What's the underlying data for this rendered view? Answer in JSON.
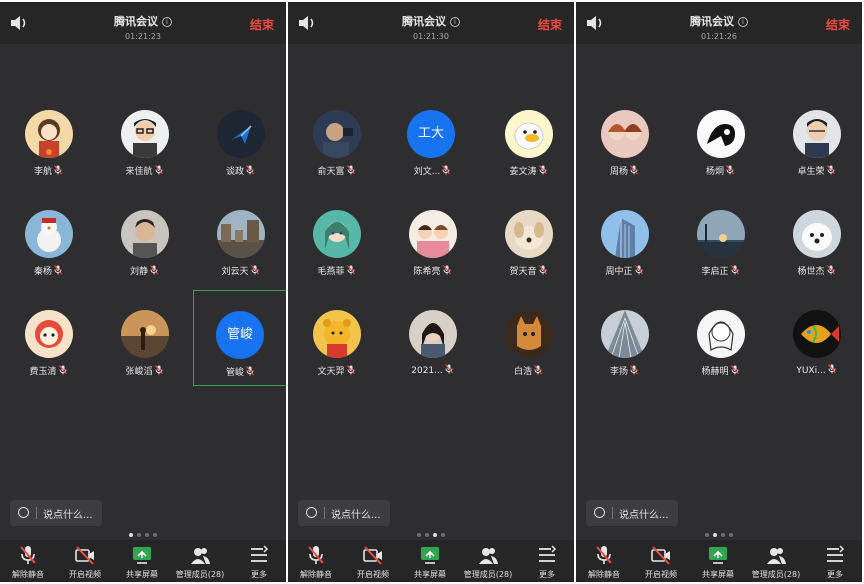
{
  "meeting": {
    "title": "腾讯会议",
    "end_label": "结束",
    "chat_placeholder": "说点什么..."
  },
  "toolbar": [
    {
      "label": "解除静音",
      "icon": "mic-muted-icon"
    },
    {
      "label": "开启视频",
      "icon": "video-off-icon"
    },
    {
      "label": "共享屏幕",
      "icon": "share-screen-icon"
    },
    {
      "label": "管理成员(28)",
      "icon": "members-icon"
    },
    {
      "label": "更多",
      "icon": "more-icon"
    }
  ],
  "panels": [
    {
      "time": "01:21:23",
      "active_page": 0,
      "participants": [
        {
          "name": "李航",
          "avatar": "cartoon-girl-avatar"
        },
        {
          "name": "来佳航",
          "avatar": "glasses-man-avatar"
        },
        {
          "name": "谈政",
          "avatar": "blue-logo-avatar"
        },
        {
          "name": "秦杨",
          "avatar": "snowman-avatar"
        },
        {
          "name": "刘静",
          "avatar": "boy-portrait-avatar"
        },
        {
          "name": "刘云天",
          "avatar": "city-street-avatar"
        },
        {
          "name": "费玉清",
          "avatar": "red-cartoon-avatar"
        },
        {
          "name": "张峻滔",
          "avatar": "sunset-avatar"
        },
        {
          "name": "管峻",
          "avatar_text": "管峻",
          "selected": true
        }
      ]
    },
    {
      "time": "01:21:30",
      "active_page": 2,
      "participants": [
        {
          "name": "俞天富",
          "avatar": "man-photo-avatar"
        },
        {
          "name": "刘文...",
          "avatar_text": "工大"
        },
        {
          "name": "姜文涛",
          "avatar": "duck-cartoon-avatar"
        },
        {
          "name": "毛燕菲",
          "avatar": "anime-girl-avatar"
        },
        {
          "name": "陈希亮",
          "avatar": "kids-cartoon-avatar"
        },
        {
          "name": "贺天音",
          "avatar": "puppy-avatar"
        },
        {
          "name": "文天羿",
          "avatar": "pooh-avatar"
        },
        {
          "name": "2021...",
          "avatar": "girl-photo-avatar"
        },
        {
          "name": "白浩",
          "avatar": "cat-avatar"
        }
      ]
    },
    {
      "time": "01:21:26",
      "active_page": 1,
      "participants": [
        {
          "name": "周杨",
          "avatar": "two-girls-avatar"
        },
        {
          "name": "杨炯",
          "avatar": "line-art-avatar"
        },
        {
          "name": "卓生荣",
          "avatar": "man-glasses-avatar"
        },
        {
          "name": "周中正",
          "avatar": "building-avatar"
        },
        {
          "name": "李启正",
          "avatar": "sunrise-avatar"
        },
        {
          "name": "杨世杰",
          "avatar": "white-dog-avatar"
        },
        {
          "name": "李扬",
          "avatar": "skyscraper-avatar"
        },
        {
          "name": "杨赫明",
          "avatar": "sketch-girl-avatar"
        },
        {
          "name": "YUXi...",
          "avatar": "colorful-fish-avatar"
        }
      ]
    }
  ]
}
